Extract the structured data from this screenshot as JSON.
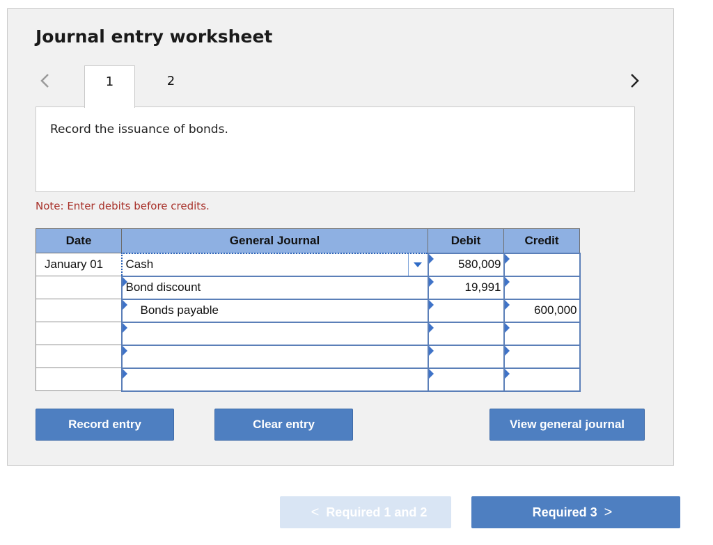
{
  "worksheet": {
    "title": "Journal entry worksheet",
    "tabs": [
      {
        "label": "1",
        "active": true
      },
      {
        "label": "2",
        "active": false
      }
    ],
    "instruction": "Record the issuance of bonds.",
    "note": "Note: Enter debits before credits."
  },
  "journal": {
    "headers": {
      "date": "Date",
      "account": "General Journal",
      "debit": "Debit",
      "credit": "Credit"
    },
    "rows": [
      {
        "date": "January 01",
        "account": "Cash",
        "debit": "580,009",
        "credit": ""
      },
      {
        "date": "",
        "account": "Bond discount",
        "debit": "19,991",
        "credit": ""
      },
      {
        "date": "",
        "account": "Bonds payable",
        "debit": "",
        "credit": "600,000"
      },
      {
        "date": "",
        "account": "",
        "debit": "",
        "credit": ""
      },
      {
        "date": "",
        "account": "",
        "debit": "",
        "credit": ""
      },
      {
        "date": "",
        "account": "",
        "debit": "",
        "credit": ""
      }
    ]
  },
  "buttons": {
    "record": "Record entry",
    "clear": "Clear entry",
    "view": "View general journal"
  },
  "bottom_nav": {
    "prev": "Required 1 and 2",
    "next": "Required 3"
  },
  "colors": {
    "header_bg": "#8eb0e2",
    "button_bg": "#4e7fc1",
    "note_text": "#a8312a",
    "disabled_bg": "#d9e5f4"
  },
  "icons": {
    "prev": "chevron-left-icon",
    "next": "chevron-right-icon",
    "dropdown": "dropdown-caret-icon"
  }
}
